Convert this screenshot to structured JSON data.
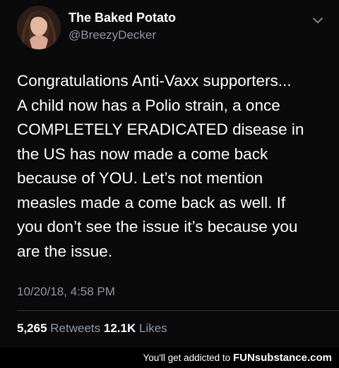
{
  "profile": {
    "display_name": "The Baked Potato",
    "handle": "@BreezyDecker"
  },
  "tweet": {
    "text": "Congratulations Anti-Vaxx supporters...\nA child now has a Polio strain, a once\nCOMPLETELY ERADICATED disease in\nthe US has now made a come back\nbecause of YOU. Let’s not mention\nmeasles made a come back as well. If\nyou don’t see the issue it’s because you\nare the issue.",
    "timestamp": "10/20/18, 4:58 PM"
  },
  "stats": {
    "retweets_count": "5,265",
    "retweets_label": "Retweets",
    "likes_count": "12.1K",
    "likes_label": "Likes"
  },
  "footer": {
    "tagline": "You'll get addicted to",
    "brand": "FUNsubstance.com"
  },
  "colors": {
    "background": "#0a0a0b",
    "primary_text": "#ffffff",
    "secondary_text": "#8b98a5",
    "divider": "#2f3336"
  },
  "icons": {
    "menu": "chevron-down-icon",
    "avatar": "profile-photo"
  }
}
